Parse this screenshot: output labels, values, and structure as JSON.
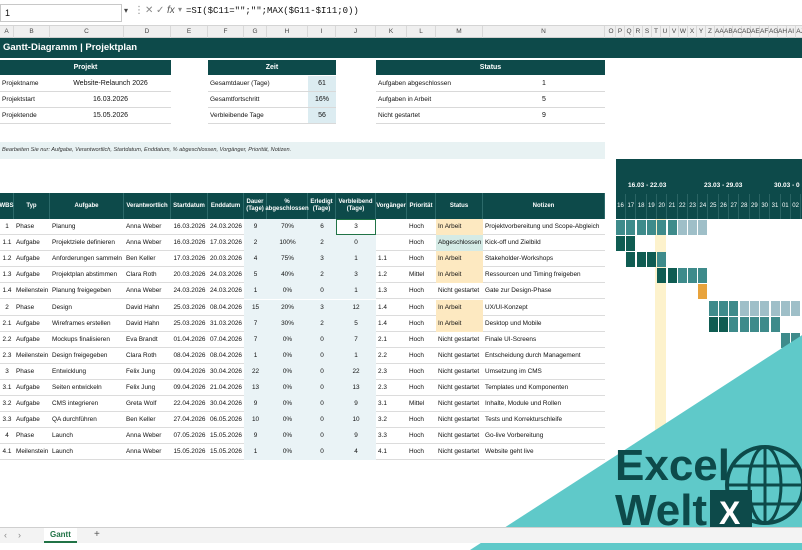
{
  "formula_bar": {
    "name_box": "1",
    "fx_label": "fx",
    "formula": "=SI($C11=\"\";\"\";MAX($G11-$I11;0))"
  },
  "columns": {
    "main": [
      "A",
      "B",
      "C",
      "D",
      "E",
      "F",
      "G",
      "H",
      "I",
      "J",
      "K",
      "L",
      "M",
      "N"
    ],
    "gantt": [
      "O",
      "P",
      "Q",
      "R",
      "S",
      "T",
      "U",
      "V",
      "W",
      "X",
      "Y",
      "Z",
      "AA",
      "AB",
      "AC",
      "AD",
      "AE",
      "AF",
      "AG",
      "AH",
      "AI",
      "AJ"
    ]
  },
  "title": "Gantt-Diagramm | Projektplan",
  "project": {
    "header": "Projekt",
    "rows": [
      {
        "label": "Projektname",
        "value": "Website-Relaunch 2026"
      },
      {
        "label": "Projektstart",
        "value": "16.03.2026"
      },
      {
        "label": "Projektende",
        "value": "15.05.2026"
      }
    ]
  },
  "time": {
    "header": "Zeit",
    "rows": [
      {
        "label": "Gesamtdauer (Tage)",
        "value": "61"
      },
      {
        "label": "Gesamtfortschritt",
        "value": "16%"
      },
      {
        "label": "Verbleibende Tage",
        "value": "56"
      }
    ]
  },
  "status_summary": {
    "header": "Status",
    "rows": [
      {
        "label": "Aufgaben abgeschlossen",
        "value": "1"
      },
      {
        "label": "Aufgaben in Arbeit",
        "value": "5"
      },
      {
        "label": "Nicht gestartet",
        "value": "9"
      }
    ]
  },
  "note": "Bearbeiten Sie nur: Aufgabe, Verantwortlich, Startdatum, Enddatum, % abgeschlossen, Vorgänger, Priorität, Notizen.",
  "table": {
    "headers": [
      "WBS",
      "Typ",
      "Aufgabe",
      "Verantwortlich",
      "Startdatum",
      "Enddatum",
      "Dauer (Tage)",
      "% abgeschlossen",
      "Erledigt (Tage)",
      "Verbleibend (Tage)",
      "Vorgänger",
      "Priorität",
      "Status",
      "Notizen"
    ],
    "rows": [
      [
        "1",
        "Phase",
        "Planung",
        "Anna Weber",
        "16.03.2026",
        "24.03.2026",
        "9",
        "70%",
        "6",
        "3",
        "",
        "Hoch",
        "In Arbeit",
        "Projektvorbereitung und Scope-Abgleich"
      ],
      [
        "1.1",
        "Aufgabe",
        "Projektziele definieren",
        "Anna Weber",
        "16.03.2026",
        "17.03.2026",
        "2",
        "100%",
        "2",
        "0",
        "",
        "Hoch",
        "Abgeschlossen",
        "Kick-off und Zielbild"
      ],
      [
        "1.2",
        "Aufgabe",
        "Anforderungen sammeln",
        "Ben Keller",
        "17.03.2026",
        "20.03.2026",
        "4",
        "75%",
        "3",
        "1",
        "1.1",
        "Hoch",
        "In Arbeit",
        "Stakeholder-Workshops"
      ],
      [
        "1.3",
        "Aufgabe",
        "Projektplan abstimmen",
        "Clara Roth",
        "20.03.2026",
        "24.03.2026",
        "5",
        "40%",
        "2",
        "3",
        "1.2",
        "Mittel",
        "In Arbeit",
        "Ressourcen und Timing freigeben"
      ],
      [
        "1.4",
        "Meilenstein",
        "Planung freigegeben",
        "Anna Weber",
        "24.03.2026",
        "24.03.2026",
        "1",
        "0%",
        "0",
        "1",
        "1.3",
        "Hoch",
        "Nicht gestartet",
        "Gate zur Design-Phase"
      ],
      [
        "2",
        "Phase",
        "Design",
        "David Hahn",
        "25.03.2026",
        "08.04.2026",
        "15",
        "20%",
        "3",
        "12",
        "1.4",
        "Hoch",
        "In Arbeit",
        "UX/UI-Konzept"
      ],
      [
        "2.1",
        "Aufgabe",
        "Wireframes erstellen",
        "David Hahn",
        "25.03.2026",
        "31.03.2026",
        "7",
        "30%",
        "2",
        "5",
        "1.4",
        "Hoch",
        "In Arbeit",
        "Desktop und Mobile"
      ],
      [
        "2.2",
        "Aufgabe",
        "Mockups finalisieren",
        "Eva Brandt",
        "01.04.2026",
        "07.04.2026",
        "7",
        "0%",
        "0",
        "7",
        "2.1",
        "Hoch",
        "Nicht gestartet",
        "Finale UI-Screens"
      ],
      [
        "2.3",
        "Meilenstein",
        "Design freigegeben",
        "Clara Roth",
        "08.04.2026",
        "08.04.2026",
        "1",
        "0%",
        "0",
        "1",
        "2.2",
        "Hoch",
        "Nicht gestartet",
        "Entscheidung durch Management"
      ],
      [
        "3",
        "Phase",
        "Entwicklung",
        "Felix Jung",
        "09.04.2026",
        "30.04.2026",
        "22",
        "0%",
        "0",
        "22",
        "2.3",
        "Hoch",
        "Nicht gestartet",
        "Umsetzung im CMS"
      ],
      [
        "3.1",
        "Aufgabe",
        "Seiten entwickeln",
        "Felix Jung",
        "09.04.2026",
        "21.04.2026",
        "13",
        "0%",
        "0",
        "13",
        "2.3",
        "Hoch",
        "Nicht gestartet",
        "Templates und Komponenten"
      ],
      [
        "3.2",
        "Aufgabe",
        "CMS integrieren",
        "Greta Wolf",
        "22.04.2026",
        "30.04.2026",
        "9",
        "0%",
        "0",
        "9",
        "3.1",
        "Mittel",
        "Nicht gestartet",
        "Inhalte, Module und Rollen"
      ],
      [
        "3.3",
        "Aufgabe",
        "QA durchführen",
        "Ben Keller",
        "27.04.2026",
        "06.05.2026",
        "10",
        "0%",
        "0",
        "10",
        "3.2",
        "Hoch",
        "Nicht gestartet",
        "Tests und Korrekturschleife"
      ],
      [
        "4",
        "Phase",
        "Launch",
        "Anna Weber",
        "07.05.2026",
        "15.05.2026",
        "9",
        "0%",
        "0",
        "9",
        "3.3",
        "Hoch",
        "Nicht gestartet",
        "Go-live Vorbereitung"
      ],
      [
        "4.1",
        "Meilenstein",
        "Launch",
        "Anna Weber",
        "15.05.2026",
        "15.05.2026",
        "1",
        "0%",
        "0",
        "4",
        "4.1",
        "Hoch",
        "Nicht gestartet",
        "Website geht live"
      ]
    ]
  },
  "gantt": {
    "weeks": [
      "16.03 - 22.03",
      "23.03 - 29.03",
      "30.03 - 0"
    ],
    "days": [
      "16",
      "17",
      "18",
      "19",
      "20",
      "21",
      "22",
      "23",
      "24",
      "25",
      "26",
      "27",
      "28",
      "29",
      "30",
      "31",
      "01",
      "02"
    ]
  },
  "sheet_tabs": {
    "active": "Gantt",
    "add": "+"
  },
  "brand": {
    "line1": "Excel",
    "line2": "Welt",
    "letter": "X"
  },
  "colors": {
    "header": "#0d4a4a",
    "phase_bar": "#9fbfc8",
    "task_bar": "#3e8b8b",
    "done_bar": "#0f5c52",
    "milestone": "#e8a33c",
    "in_progress": "#fde9c1",
    "brand_teal": "#5fc9c9"
  }
}
